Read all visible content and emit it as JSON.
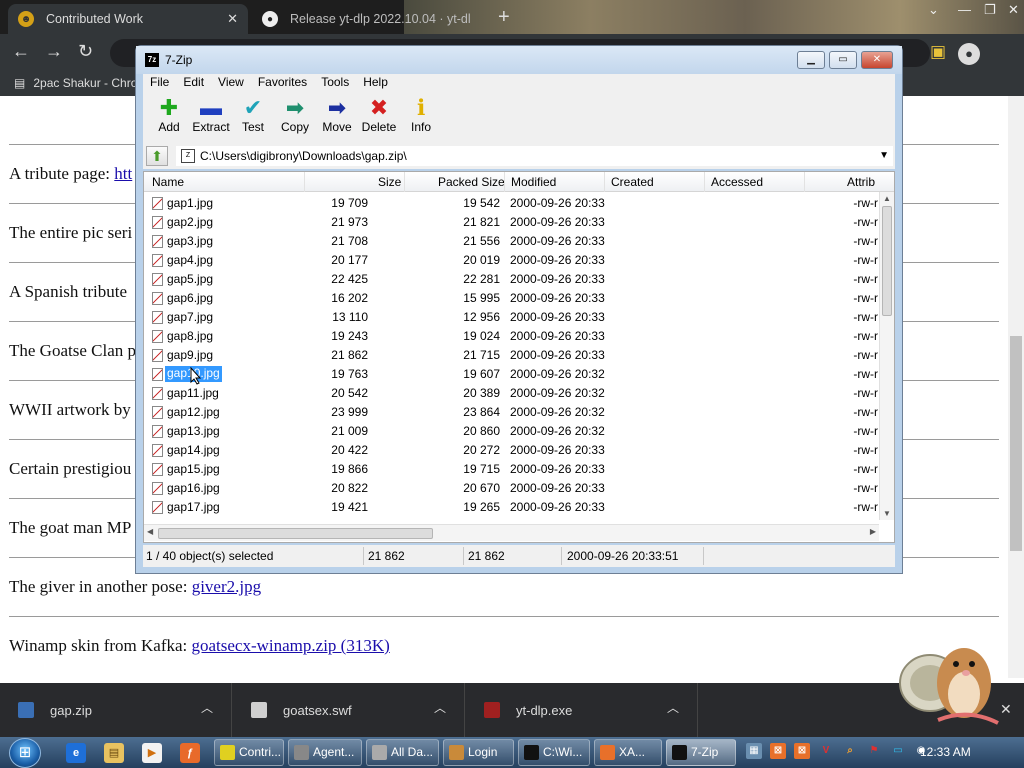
{
  "browser": {
    "tabs": [
      {
        "title": "Contributed Work"
      },
      {
        "title": "Release yt-dlp 2022.10.04 · yt-dl"
      }
    ],
    "bookmark": "2pac Shakur - Chro",
    "page_rows": [
      {
        "text": "A tribute page: ",
        "link": "htt"
      },
      {
        "text": "The entire pic seri",
        "link": ""
      },
      {
        "text": "A Spanish tribute",
        "link": ""
      },
      {
        "text": "The Goatse Clan p",
        "link": ""
      },
      {
        "text": "WWII artwork by",
        "link": ""
      },
      {
        "text": "Certain prestigiou",
        "link": ""
      },
      {
        "text": "The goat man MP",
        "link": ""
      },
      {
        "text": "The giver in another pose: ",
        "link": "giver2.jpg"
      },
      {
        "text": "Winamp skin from Kafka: ",
        "link": "goatsecx-winamp.zip (313K)"
      }
    ]
  },
  "zip": {
    "title": "7-Zip",
    "menu": [
      "File",
      "Edit",
      "View",
      "Favorites",
      "Tools",
      "Help"
    ],
    "toolbar": [
      {
        "label": "Add",
        "icon": "plus-icon",
        "color": "#1ea81e",
        "glyph": "✚"
      },
      {
        "label": "Extract",
        "icon": "minus-icon",
        "color": "#1f3fbf",
        "glyph": "▬"
      },
      {
        "label": "Test",
        "icon": "check-icon",
        "color": "#1fa3b8",
        "glyph": "✔"
      },
      {
        "label": "Copy",
        "icon": "copy-arrow-icon",
        "color": "#1f8f6e",
        "glyph": "➡"
      },
      {
        "label": "Move",
        "icon": "move-arrow-icon",
        "color": "#1c2fa0",
        "glyph": "➡"
      },
      {
        "label": "Delete",
        "icon": "delete-x-icon",
        "color": "#d42020",
        "glyph": "✖"
      },
      {
        "label": "Info",
        "icon": "info-icon",
        "color": "#e0b000",
        "glyph": "ℹ"
      }
    ],
    "path": "C:\\Users\\digibrony\\Downloads\\gap.zip\\",
    "columns": [
      "Name",
      "Size",
      "Packed Size",
      "Modified",
      "Created",
      "Accessed",
      "Attrib"
    ],
    "files": [
      {
        "name": "gap1.jpg",
        "size": "19 709",
        "packed": "19 542",
        "modified": "2000-09-26 20:33",
        "attrib": "-rw-r"
      },
      {
        "name": "gap2.jpg",
        "size": "21 973",
        "packed": "21 821",
        "modified": "2000-09-26 20:33",
        "attrib": "-rw-r"
      },
      {
        "name": "gap3.jpg",
        "size": "21 708",
        "packed": "21 556",
        "modified": "2000-09-26 20:33",
        "attrib": "-rw-r"
      },
      {
        "name": "gap4.jpg",
        "size": "20 177",
        "packed": "20 019",
        "modified": "2000-09-26 20:33",
        "attrib": "-rw-r"
      },
      {
        "name": "gap5.jpg",
        "size": "22 425",
        "packed": "22 281",
        "modified": "2000-09-26 20:33",
        "attrib": "-rw-r"
      },
      {
        "name": "gap6.jpg",
        "size": "16 202",
        "packed": "15 995",
        "modified": "2000-09-26 20:33",
        "attrib": "-rw-r"
      },
      {
        "name": "gap7.jpg",
        "size": "13 110",
        "packed": "12 956",
        "modified": "2000-09-26 20:33",
        "attrib": "-rw-r"
      },
      {
        "name": "gap8.jpg",
        "size": "19 243",
        "packed": "19 024",
        "modified": "2000-09-26 20:33",
        "attrib": "-rw-r"
      },
      {
        "name": "gap9.jpg",
        "size": "21 862",
        "packed": "21 715",
        "modified": "2000-09-26 20:33",
        "attrib": "-rw-r"
      },
      {
        "name": "gap10.jpg",
        "size": "19 763",
        "packed": "19 607",
        "modified": "2000-09-26 20:32",
        "attrib": "-rw-r"
      },
      {
        "name": "gap11.jpg",
        "size": "20 542",
        "packed": "20 389",
        "modified": "2000-09-26 20:32",
        "attrib": "-rw-r"
      },
      {
        "name": "gap12.jpg",
        "size": "23 999",
        "packed": "23 864",
        "modified": "2000-09-26 20:32",
        "attrib": "-rw-r"
      },
      {
        "name": "gap13.jpg",
        "size": "21 009",
        "packed": "20 860",
        "modified": "2000-09-26 20:32",
        "attrib": "-rw-r"
      },
      {
        "name": "gap14.jpg",
        "size": "20 422",
        "packed": "20 272",
        "modified": "2000-09-26 20:33",
        "attrib": "-rw-r"
      },
      {
        "name": "gap15.jpg",
        "size": "19 866",
        "packed": "19 715",
        "modified": "2000-09-26 20:33",
        "attrib": "-rw-r"
      },
      {
        "name": "gap16.jpg",
        "size": "20 822",
        "packed": "20 670",
        "modified": "2000-09-26 20:33",
        "attrib": "-rw-r"
      },
      {
        "name": "gap17.jpg",
        "size": "19 421",
        "packed": "19 265",
        "modified": "2000-09-26 20:33",
        "attrib": "-rw-r"
      }
    ],
    "selected_index": 9,
    "status": {
      "selection": "1 / 40 object(s) selected",
      "size": "21 862",
      "packed": "21 862",
      "modified": "2000-09-26 20:33:51"
    }
  },
  "downloads": [
    {
      "name": "gap.zip",
      "icon": "zip-file-icon",
      "color": "#3a6fb5"
    },
    {
      "name": "goatsex.swf",
      "icon": "swf-file-icon",
      "color": "#cfcfcf"
    },
    {
      "name": "yt-dlp.exe",
      "icon": "exe-file-icon",
      "color": "#a02020"
    }
  ],
  "taskbar": {
    "items": [
      {
        "label": "Contri...",
        "icon": "chrome-icon",
        "color": "#e0d020",
        "text_color": "#fff"
      },
      {
        "label": "Agent...",
        "icon": "agent-icon",
        "color": "#888888",
        "text_color": "#fff"
      },
      {
        "label": "All Da...",
        "icon": "folder-window-icon",
        "color": "#aaaaaa",
        "text_color": "#fff"
      },
      {
        "label": "Login",
        "icon": "login-icon",
        "color": "#c98a3a",
        "text_color": "#fff"
      },
      {
        "label": "C:\\Wi...",
        "icon": "cmd-icon",
        "color": "#111111",
        "text_color": "#fff"
      },
      {
        "label": "XA...",
        "icon": "xampp-icon",
        "color": "#e8702a",
        "text_color": "#fff"
      },
      {
        "label": "7-Zip",
        "icon": "7zip-icon",
        "color": "#111111",
        "text_color": "#fff"
      }
    ],
    "clock": "12:33 AM"
  }
}
